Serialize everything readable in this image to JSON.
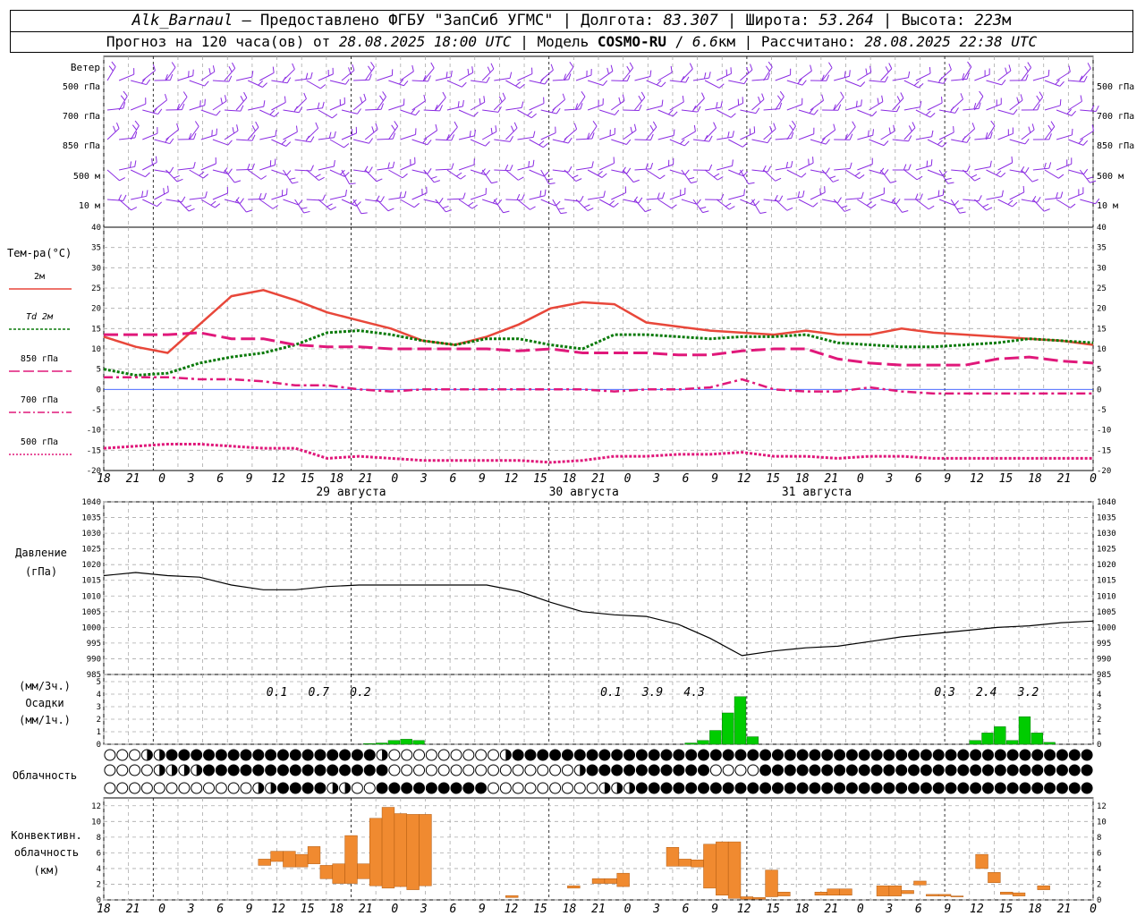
{
  "header": {
    "station": "Alk_Barnaul",
    "provider": " — Предоставлено ФГБУ \"ЗапСиб УГМС\" | Долгота: ",
    "lon": "83.307",
    "lat_label": " | Широта: ",
    "lat": "53.264",
    "alt_label": " | Высота: ",
    "alt": "223",
    "alt_unit": "м",
    "fc_label": "Прогноз на 120 часа(ов) от ",
    "fc_time": "28.08.2025 18:00 UTC",
    "model_label": "  | Модель ",
    "model": "COSMO-RU",
    "res_sep": " / ",
    "res": "6.6",
    "res_unit": "км",
    "calc_label": " | Рассчитано: ",
    "calc_time": "28.08.2025 22:38 UTC"
  },
  "colors": {
    "wind": "#8a2be2",
    "t2m": "#e8473a",
    "td2m": "#0a7a0a",
    "t850": "#e0187a",
    "pressure": "#000000",
    "precip": "#00cc00",
    "convective": "#f08a30",
    "grid": "#aaaaaa"
  },
  "labels": {
    "wind": "Ветер",
    "wind_levels": [
      "500 гПа",
      "700 гПа",
      "850 гПа",
      "500 м",
      "10  м"
    ],
    "temp_title": "Тем-ра(°C)",
    "temp_legend": [
      "2м",
      "Td  2м",
      "850 гПа",
      "700 гПа",
      "500 гПа"
    ],
    "pressure_title": "Давление",
    "pressure_unit": "(гПа)",
    "precip_unit3": "(мм/3ч.)",
    "precip_title": "Осадки",
    "precip_unit1": "(мм/1ч.)",
    "cloud_title": "Облачность",
    "conv_title1": "Конвективн.",
    "conv_title2": "облачность",
    "conv_unit": "(км)",
    "dates": [
      "29 августа",
      "30 августа",
      "31 августа"
    ]
  },
  "chart_data": [
    {
      "type": "line",
      "name": "temperature",
      "x_hours": [
        0,
        3,
        6,
        9,
        12,
        15,
        18,
        21,
        24,
        27,
        30,
        33,
        36,
        39,
        42,
        45,
        48,
        51,
        54,
        57,
        60,
        63,
        66,
        69,
        72,
        75,
        78,
        81,
        84,
        87,
        90,
        93,
        96,
        99,
        102,
        105,
        108,
        111,
        114,
        117,
        120
      ],
      "x_ticks": [
        "18",
        "21",
        "0",
        "3",
        "6",
        "9",
        "12",
        "15",
        "18",
        "21",
        "0",
        "3",
        "6",
        "9",
        "12",
        "15",
        "18",
        "21",
        "0",
        "3",
        "6",
        "9",
        "12",
        "15",
        "18",
        "21",
        "0",
        "3",
        "6",
        "9",
        "12",
        "15",
        "18",
        "21",
        "0"
      ],
      "ylim": [
        -20,
        40
      ],
      "yticks": [
        -20,
        -15,
        -10,
        -5,
        0,
        5,
        10,
        15,
        20,
        25,
        30,
        35,
        40
      ],
      "series": [
        {
          "name": "2м",
          "values": [
            13,
            10.5,
            9,
            16,
            23,
            24.5,
            22,
            19,
            17,
            15,
            12,
            11,
            13,
            16,
            20,
            21.5,
            21,
            16.5,
            15.5,
            14.5,
            14,
            13.5,
            14.5,
            13.5,
            13.5,
            15,
            14,
            13.5,
            13,
            12.5,
            12,
            11
          ]
        },
        {
          "name": "Td  2м",
          "values": [
            5,
            3.5,
            4,
            6.5,
            8,
            9,
            11,
            14,
            14.5,
            13.5,
            12,
            11,
            12.5,
            12.5,
            11,
            10,
            13.5,
            13.5,
            13,
            12.5,
            13,
            13,
            13.5,
            11.5,
            11,
            10.5,
            10.5,
            11,
            11.5,
            12.5,
            12,
            11.5
          ]
        },
        {
          "name": "850 гПа",
          "values": [
            13.5,
            13.5,
            13.5,
            14,
            12.5,
            12.5,
            11,
            10.5,
            10.5,
            10,
            10,
            10,
            10,
            9.5,
            10,
            9,
            9,
            9,
            8.5,
            8.5,
            9.5,
            10,
            10,
            7.5,
            6.5,
            6,
            6,
            6,
            7.5,
            8,
            7,
            6.5
          ]
        },
        {
          "name": "700 гПа",
          "values": [
            3,
            3,
            3,
            2.5,
            2.5,
            2,
            1,
            1,
            0,
            -0.5,
            0,
            0,
            0,
            0,
            0,
            0,
            -0.5,
            0,
            0,
            0.5,
            2.5,
            0,
            -0.5,
            -0.5,
            0.5,
            -0.5,
            -1,
            -1,
            -1,
            -1,
            -1,
            -1
          ]
        },
        {
          "name": "500 гПа",
          "values": [
            -14.5,
            -14,
            -13.5,
            -13.5,
            -14,
            -14.5,
            -14.5,
            -17,
            -16.5,
            -17,
            -17.5,
            -17.5,
            -17.5,
            -17.5,
            -18,
            -17.5,
            -16.5,
            -16.5,
            -16,
            -16,
            -15.5,
            -16.5,
            -16.5,
            -17,
            -16.5,
            -16.5,
            -17,
            -17,
            -17,
            -17,
            -17,
            -17
          ]
        }
      ]
    },
    {
      "type": "line",
      "name": "pressure",
      "ylim": [
        985,
        1040
      ],
      "yticks": [
        985,
        990,
        995,
        1000,
        1005,
        1010,
        1015,
        1020,
        1025,
        1030,
        1035,
        1040
      ],
      "series": [
        {
          "name": "Давление",
          "values": [
            1016.5,
            1017.5,
            1016.5,
            1016,
            1013.5,
            1012,
            1012,
            1013,
            1013.5,
            1013.5,
            1013.5,
            1013.5,
            1013.5,
            1011.5,
            1008,
            1005,
            1004,
            1003.5,
            1001,
            996.5,
            991,
            992.5,
            993.5,
            994,
            995.5,
            997,
            998,
            999,
            1000,
            1000.5,
            1001.5,
            1002
          ]
        }
      ]
    },
    {
      "type": "bar",
      "name": "precipitation",
      "ylim": [
        0,
        5
      ],
      "yticks": [
        0,
        1,
        2,
        3,
        4,
        5
      ],
      "labels_3h": [
        {
          "hour": 12,
          "text": "0.1"
        },
        {
          "hour": 15,
          "text": "0.7"
        },
        {
          "hour": 18,
          "text": "0.2"
        },
        {
          "hour": 36,
          "text": "0.1"
        },
        {
          "hour": 39,
          "text": "3.9"
        },
        {
          "hour": 42,
          "text": "4.3"
        },
        {
          "hour": 60,
          "text": "0.3"
        },
        {
          "hour": 63,
          "text": "2.4"
        },
        {
          "hour": 66,
          "text": "3.2"
        }
      ],
      "bars_1h": [
        {
          "hour": 21.5,
          "value": 0.05
        },
        {
          "hour": 22.5,
          "value": 0.1
        },
        {
          "hour": 23.5,
          "value": 0.3
        },
        {
          "hour": 24.5,
          "value": 0.4
        },
        {
          "hour": 25.5,
          "value": 0.3
        },
        {
          "hour": 47.5,
          "value": 0.1
        },
        {
          "hour": 48.5,
          "value": 0.3
        },
        {
          "hour": 49.5,
          "value": 1.1
        },
        {
          "hour": 50.5,
          "value": 2.5
        },
        {
          "hour": 51.5,
          "value": 3.8
        },
        {
          "hour": 52.5,
          "value": 0.6
        },
        {
          "hour": 70.5,
          "value": 0.3
        },
        {
          "hour": 71.5,
          "value": 0.9
        },
        {
          "hour": 72.5,
          "value": 1.4
        },
        {
          "hour": 73.5,
          "value": 0.3
        },
        {
          "hour": 74.5,
          "value": 2.2
        },
        {
          "hour": 75.5,
          "value": 0.9
        },
        {
          "hour": 76.5,
          "value": 0.15
        }
      ]
    },
    {
      "type": "bar",
      "name": "convective_cloud",
      "ylim": [
        0,
        13
      ],
      "yticks": [
        0,
        2,
        4,
        6,
        8,
        10,
        12
      ],
      "bars": [
        {
          "hour": 13,
          "bottom": 4.4,
          "top": 5.2
        },
        {
          "hour": 14,
          "bottom": 4.9,
          "top": 6.2
        },
        {
          "hour": 15,
          "bottom": 4.2,
          "top": 6.2
        },
        {
          "hour": 16,
          "bottom": 4.2,
          "top": 5.8
        },
        {
          "hour": 17,
          "bottom": 4.6,
          "top": 6.8
        },
        {
          "hour": 18,
          "bottom": 2.7,
          "top": 4.4
        },
        {
          "hour": 19,
          "bottom": 2.1,
          "top": 4.6
        },
        {
          "hour": 20,
          "bottom": 2.1,
          "top": 8.2
        },
        {
          "hour": 21,
          "bottom": 2.7,
          "top": 4.6
        },
        {
          "hour": 22,
          "bottom": 1.8,
          "top": 10.4
        },
        {
          "hour": 23,
          "bottom": 1.5,
          "top": 11.8
        },
        {
          "hour": 24,
          "bottom": 1.7,
          "top": 11.0
        },
        {
          "hour": 25,
          "bottom": 1.3,
          "top": 10.9
        },
        {
          "hour": 26,
          "bottom": 1.8,
          "top": 10.9
        },
        {
          "hour": 33,
          "bottom": 0.3,
          "top": 0.55
        },
        {
          "hour": 38,
          "bottom": 1.5,
          "top": 1.8
        },
        {
          "hour": 40,
          "bottom": 2.1,
          "top": 2.7
        },
        {
          "hour": 41,
          "bottom": 2.1,
          "top": 2.7
        },
        {
          "hour": 42,
          "bottom": 1.7,
          "top": 3.4
        },
        {
          "hour": 46,
          "bottom": 4.3,
          "top": 6.7
        },
        {
          "hour": 47,
          "bottom": 4.3,
          "top": 5.2
        },
        {
          "hour": 48,
          "bottom": 4.2,
          "top": 5.1
        },
        {
          "hour": 49,
          "bottom": 1.5,
          "top": 7.1
        },
        {
          "hour": 50,
          "bottom": 0.6,
          "top": 7.4
        },
        {
          "hour": 51,
          "bottom": 0.2,
          "top": 7.4
        },
        {
          "hour": 52,
          "bottom": 0.1,
          "top": 0.4
        },
        {
          "hour": 53,
          "bottom": 0.1,
          "top": 0.3
        },
        {
          "hour": 54,
          "bottom": 0.4,
          "top": 3.8
        },
        {
          "hour": 55,
          "bottom": 0.5,
          "top": 1.0
        },
        {
          "hour": 58,
          "bottom": 0.6,
          "top": 1.0
        },
        {
          "hour": 59,
          "bottom": 0.6,
          "top": 1.4
        },
        {
          "hour": 60,
          "bottom": 0.6,
          "top": 1.4
        },
        {
          "hour": 63,
          "bottom": 0.5,
          "top": 1.8
        },
        {
          "hour": 64,
          "bottom": 0.5,
          "top": 1.8
        },
        {
          "hour": 65,
          "bottom": 0.8,
          "top": 1.2
        },
        {
          "hour": 66,
          "bottom": 1.9,
          "top": 2.4
        },
        {
          "hour": 67,
          "bottom": 0.5,
          "top": 0.7
        },
        {
          "hour": 68,
          "bottom": 0.5,
          "top": 0.7
        },
        {
          "hour": 69,
          "bottom": 0.4,
          "top": 0.5
        },
        {
          "hour": 71,
          "bottom": 4.0,
          "top": 5.8
        },
        {
          "hour": 72,
          "bottom": 2.2,
          "top": 3.5
        },
        {
          "hour": 73,
          "bottom": 0.7,
          "top": 1.0
        },
        {
          "hour": 74,
          "bottom": 0.5,
          "top": 0.9
        },
        {
          "hour": 76,
          "bottom": 1.3,
          "top": 1.8
        }
      ]
    }
  ],
  "cloud_rows": {
    "note_levels": [
      "upper",
      "middle",
      "lower"
    ],
    "upper": "00000HHHFFFFFFFFFFFFFFFFFFFFFFFFFFFFFFFFHH0000000000000000HFFFFFFFFFFFFFFFFFFFFFFFFFFFFFFFFFFFFFFFFFFFFFFFFFFFFFFFFFFFFFFFFFFFFFFFFFFFFFFFFFFFFFFFF",
    "middle": "0000000HHHHHHHFFFFFFFFFFFFFFFFFFFFFFFFFFF00000000000000000000000000000HHFFFFFFFFFFFFFFFFFFF000000FFFFFFFFFFFFFFFFFFFFFFFFFFFFFFFFFFFFFFFFFFFFFFFFFFFF",
    "lower": "000000000000000000000HHHHFFFFFFFFHHHH000HFFFFFFFFFFFFFFFFF00000000000000000HHHHHFFFFFFFFFFFFFFFFFFFFFFFFFFFFFFFFFFFFFFFFFFFFFFFFFFFFFFFFFFFFFFFFFFFFFFF"
  }
}
